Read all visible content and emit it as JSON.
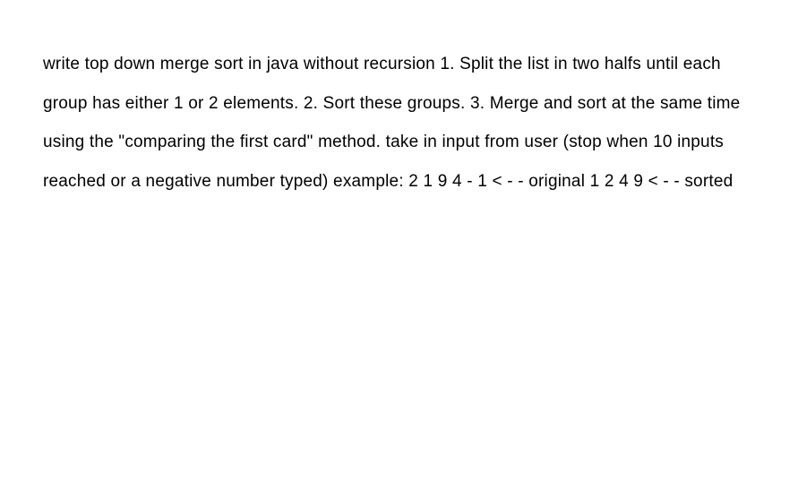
{
  "document": {
    "text": "write top down merge sort in java without recursion 1. Split the list in two halfs until each group has either 1 or 2 elements. 2. Sort these groups. 3. Merge and sort at the same time using the \"comparing the first card\" method. take in input from user (stop when 10 inputs reached or a negative number typed) example: 2 1 9 4 - 1 < - - original 1 2 4 9 < - - sorted"
  }
}
